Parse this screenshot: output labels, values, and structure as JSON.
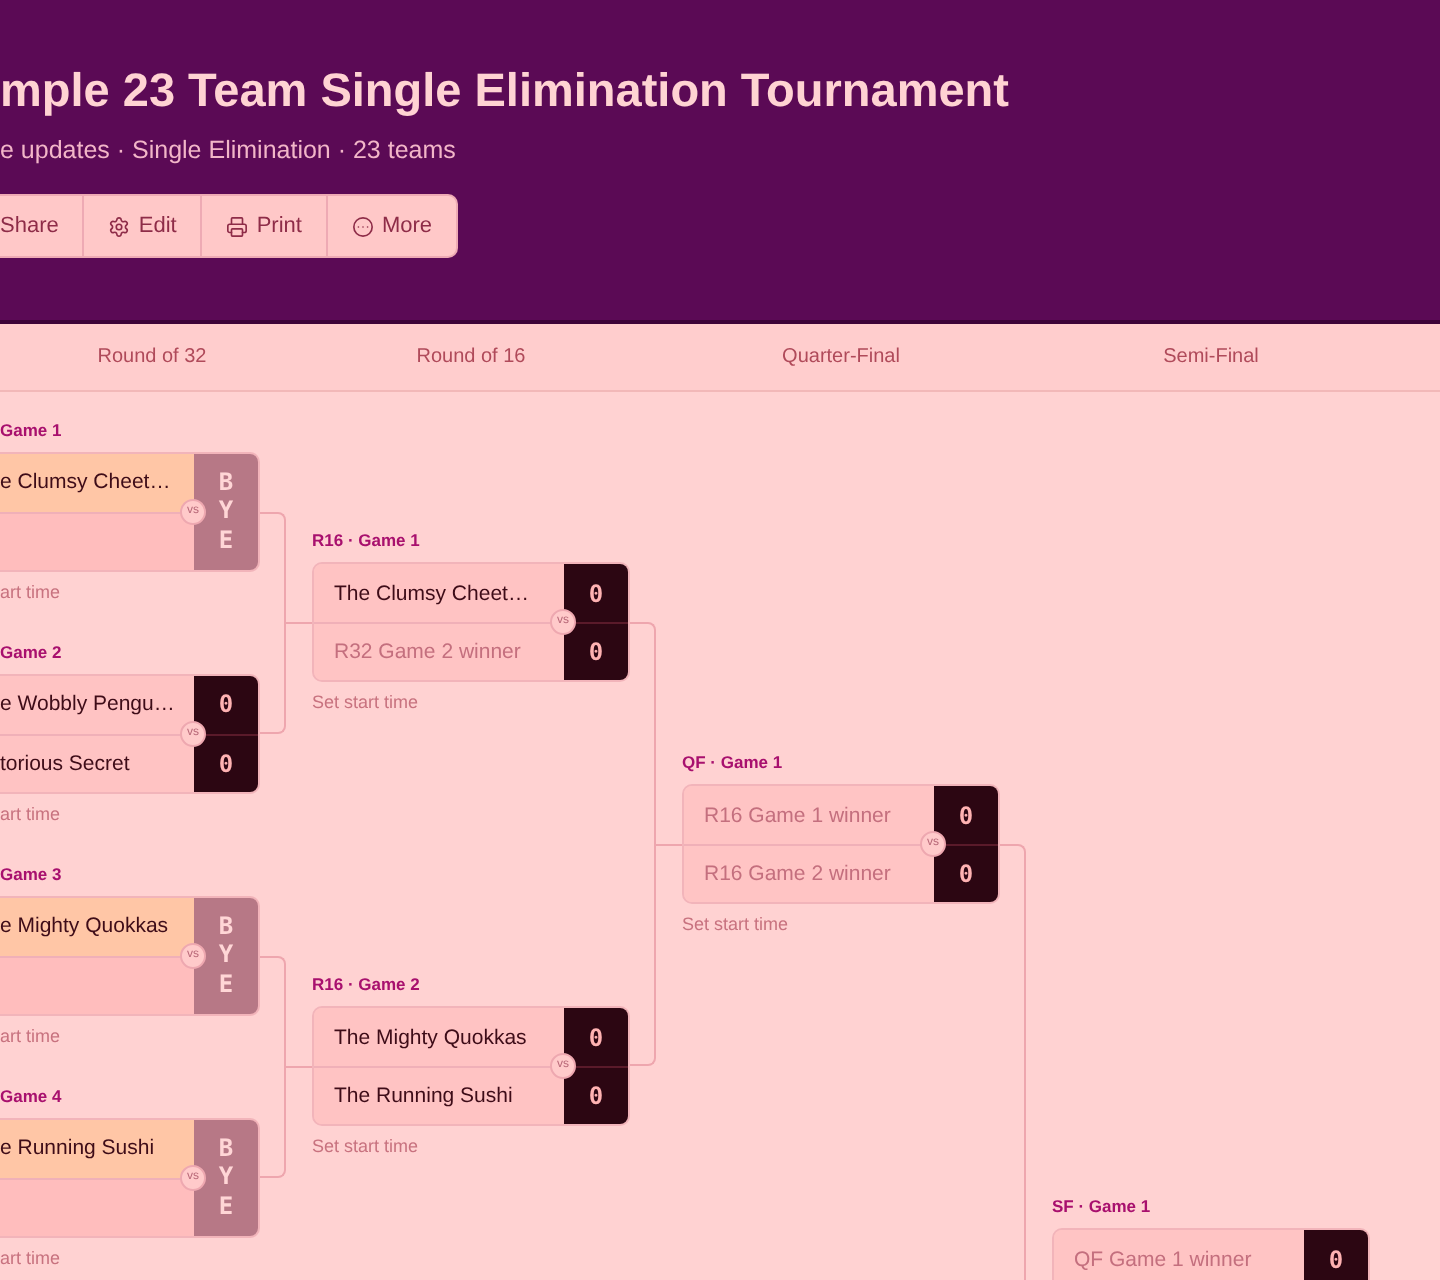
{
  "header": {
    "title": "mple 23 Team Single Elimination Tournament",
    "meta": "e updates · Single Elimination · 23 teams",
    "actions": [
      {
        "label": "Share"
      },
      {
        "label": "Edit"
      },
      {
        "label": "Print"
      },
      {
        "label": "More"
      }
    ]
  },
  "rounds": [
    {
      "title": "Round of 32",
      "games": [
        {
          "label": "Game 1",
          "kind": "bye",
          "bye": "BYE",
          "vs": "vs",
          "teams": [
            {
              "name": "e Clumsy Cheet…",
              "kind": "team",
              "advanced": true
            },
            {
              "kind": "empty",
              "advanced": false
            }
          ],
          "start_time": "art time"
        },
        {
          "label": "Game 2",
          "kind": "scored",
          "vs": "vs",
          "teams": [
            {
              "name": "e Wobbly Pengu…",
              "kind": "team",
              "advanced": false,
              "score": "0"
            },
            {
              "name": "torious Secret",
              "kind": "team",
              "advanced": false,
              "score": "0"
            }
          ],
          "start_time": "art time"
        },
        {
          "label": "Game 3",
          "kind": "bye",
          "bye": "BYE",
          "vs": "vs",
          "teams": [
            {
              "name": "e Mighty Quokkas",
              "kind": "team",
              "advanced": true
            },
            {
              "kind": "empty",
              "advanced": false
            }
          ],
          "start_time": "art time"
        },
        {
          "label": "Game 4",
          "kind": "bye",
          "bye": "BYE",
          "vs": "vs",
          "teams": [
            {
              "name": "e Running Sushi",
              "kind": "team",
              "advanced": true
            },
            {
              "kind": "empty",
              "advanced": false
            }
          ],
          "start_time": "art time"
        }
      ]
    },
    {
      "title": "Round of 16",
      "games": [
        {
          "label": "R16 · Game 1",
          "kind": "scored",
          "vs": "vs",
          "teams": [
            {
              "name": "The Clumsy Cheet…",
              "kind": "team",
              "advanced": false,
              "score": "0"
            },
            {
              "name": "R32 Game 2 winner",
              "kind": "placeholder",
              "advanced": false,
              "score": "0"
            }
          ],
          "start_time": "Set start time"
        },
        {
          "label": "R16 · Game 2",
          "kind": "scored",
          "vs": "vs",
          "teams": [
            {
              "name": "The Mighty Quokkas",
              "kind": "team",
              "advanced": false,
              "score": "0"
            },
            {
              "name": "The Running Sushi",
              "kind": "team",
              "advanced": false,
              "score": "0"
            }
          ],
          "start_time": "Set start time"
        }
      ]
    },
    {
      "title": "Quarter-Final",
      "games": [
        {
          "label": "QF · Game 1",
          "kind": "scored",
          "vs": "vs",
          "teams": [
            {
              "name": "R16 Game 1 winner",
              "kind": "placeholder",
              "advanced": false,
              "score": "0"
            },
            {
              "name": "R16 Game 2 winner",
              "kind": "placeholder",
              "advanced": false,
              "score": "0"
            }
          ],
          "start_time": "Set start time"
        }
      ]
    },
    {
      "title": "Semi-Final",
      "games": [
        {
          "label": "SF · Game 1",
          "kind": "scored",
          "teams": [
            {
              "name": "QF Game 1 winner",
              "kind": "placeholder",
              "advanced": false,
              "score": "0"
            }
          ]
        }
      ]
    }
  ]
}
